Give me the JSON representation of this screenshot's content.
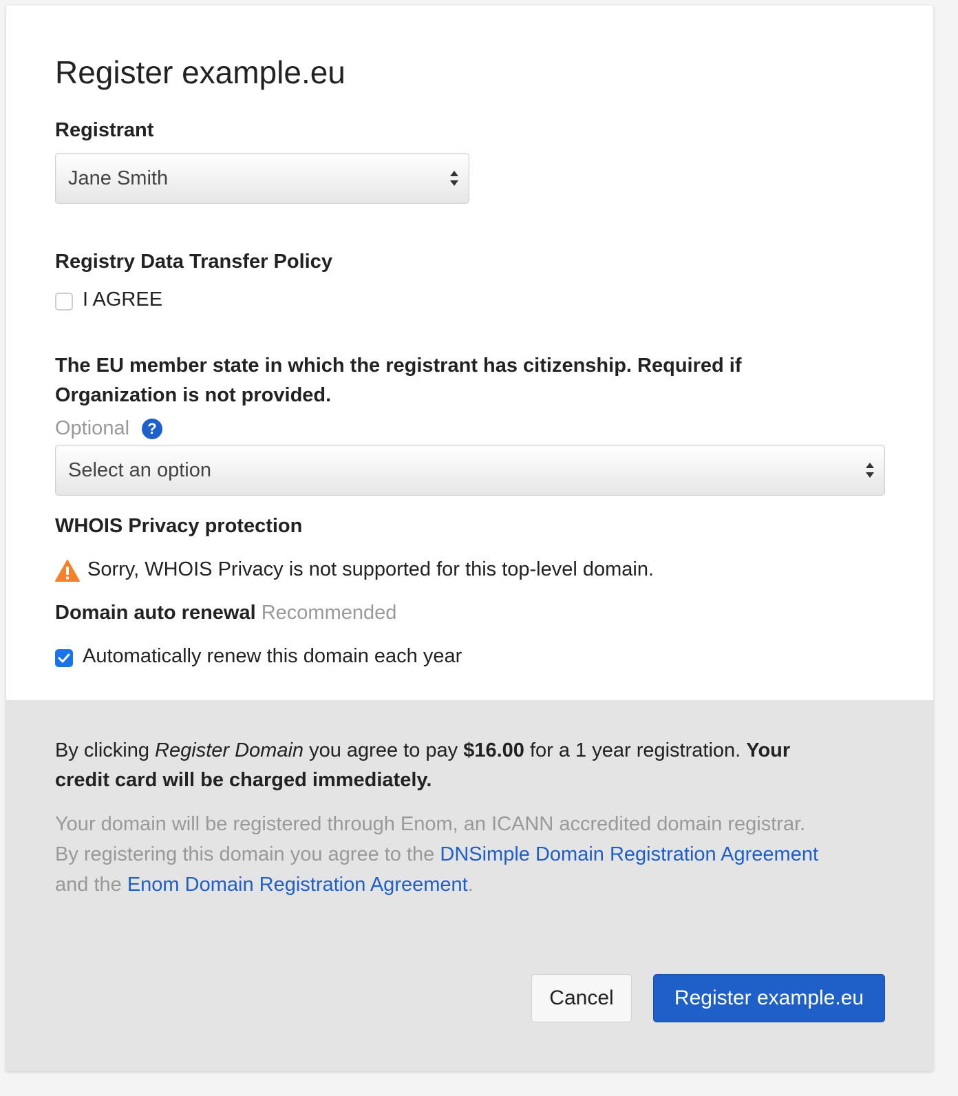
{
  "dialog": {
    "title": "Register example.eu"
  },
  "registrant": {
    "label": "Registrant",
    "selected": "Jane Smith"
  },
  "policy": {
    "label": "Registry Data Transfer Policy",
    "agree_label": "I AGREE",
    "checked": false
  },
  "citizenship": {
    "label_line1": "The EU member state in which the registrant has citizenship. Required if",
    "label_line2": "Organization is not provided.",
    "optional": "Optional",
    "help_glyph": "?",
    "selected": "Select an option"
  },
  "whois": {
    "label": "WHOIS Privacy protection",
    "warning_icon": "warning-triangle-icon",
    "message": "Sorry, WHOIS Privacy is not supported for this top-level domain."
  },
  "renewal": {
    "label": "Domain auto renewal",
    "recommended": "Recommended",
    "checkbox_label": "Automatically renew this domain each year",
    "checked": true
  },
  "footer": {
    "p1_a": "By clicking ",
    "p1_em": "Register Domain",
    "p1_b": " you agree to pay ",
    "p1_price": "$16.00",
    "p1_c": " for a 1 year registration. ",
    "p1_strong": "Your",
    "p1_strong2": "credit card will be charged immediately.",
    "p2_line1": "Your domain will be registered through Enom, an ICANN accredited domain registrar.",
    "p2_line2_a": "By registering this domain you agree to the ",
    "link1": "DNSimple Domain Registration Agreement",
    "p2_line3_a": "and the ",
    "link2": "Enom Domain Registration Agreement",
    "p2_line3_b": "."
  },
  "buttons": {
    "cancel": "Cancel",
    "register": "Register example.eu"
  },
  "colors": {
    "primary": "#1e5fc8",
    "warning": "#f5822a",
    "footer_bg": "#e4e4e4"
  }
}
